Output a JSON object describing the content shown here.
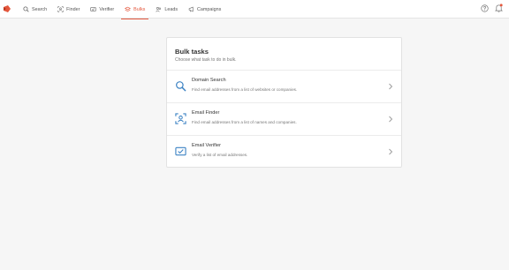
{
  "nav": {
    "items": [
      {
        "label": "Search",
        "icon": "search-icon"
      },
      {
        "label": "Finder",
        "icon": "finder-icon"
      },
      {
        "label": "Verifier",
        "icon": "verifier-icon"
      },
      {
        "label": "Bulks",
        "icon": "bulks-icon",
        "active": true
      },
      {
        "label": "Leads",
        "icon": "leads-icon"
      },
      {
        "label": "Campaigns",
        "icon": "campaigns-icon"
      }
    ]
  },
  "colors": {
    "accent": "#e4573d",
    "icon_blue": "#3d83c4"
  },
  "bulk": {
    "title": "Bulk tasks",
    "subtitle": "Choose what task to do in bulk.",
    "tasks": [
      {
        "title": "Domain Search",
        "description": "Find email addresses from a list of websites or companies.",
        "icon": "domain-search-icon"
      },
      {
        "title": "Email Finder",
        "description": "Find email addresses from a list of names and companies.",
        "icon": "email-finder-icon"
      },
      {
        "title": "Email Verifier",
        "description": "Verify a list of email addresses.",
        "icon": "email-verifier-icon"
      }
    ]
  }
}
